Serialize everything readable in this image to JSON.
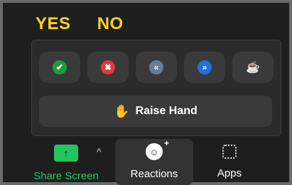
{
  "labels": {
    "yes": "YES",
    "no": "NO"
  },
  "reactions": [
    {
      "name": "yes-reaction",
      "icon": "check-icon",
      "glyph": "✔",
      "color": "#1f9d3a"
    },
    {
      "name": "no-reaction",
      "icon": "x-icon",
      "glyph": "✖",
      "color": "#e0393e"
    },
    {
      "name": "slower-reaction",
      "icon": "rewind-icon",
      "glyph": "«",
      "color": "#6b7a99"
    },
    {
      "name": "faster-reaction",
      "icon": "fast-forward-icon",
      "glyph": "»",
      "color": "#1f6fe0"
    },
    {
      "name": "coffee-reaction",
      "icon": "coffee-icon",
      "glyph": "☕",
      "color": "#3a3a3a"
    }
  ],
  "raise_hand": {
    "label": "Raise Hand",
    "icon": "raised-hand-icon",
    "glyph": "✋"
  },
  "toolbar": {
    "share_screen": "Share Screen",
    "reactions": "Reactions",
    "apps": "Apps"
  },
  "colors": {
    "share_green": "#22c55e",
    "label_yellow": "#ffd21f"
  }
}
